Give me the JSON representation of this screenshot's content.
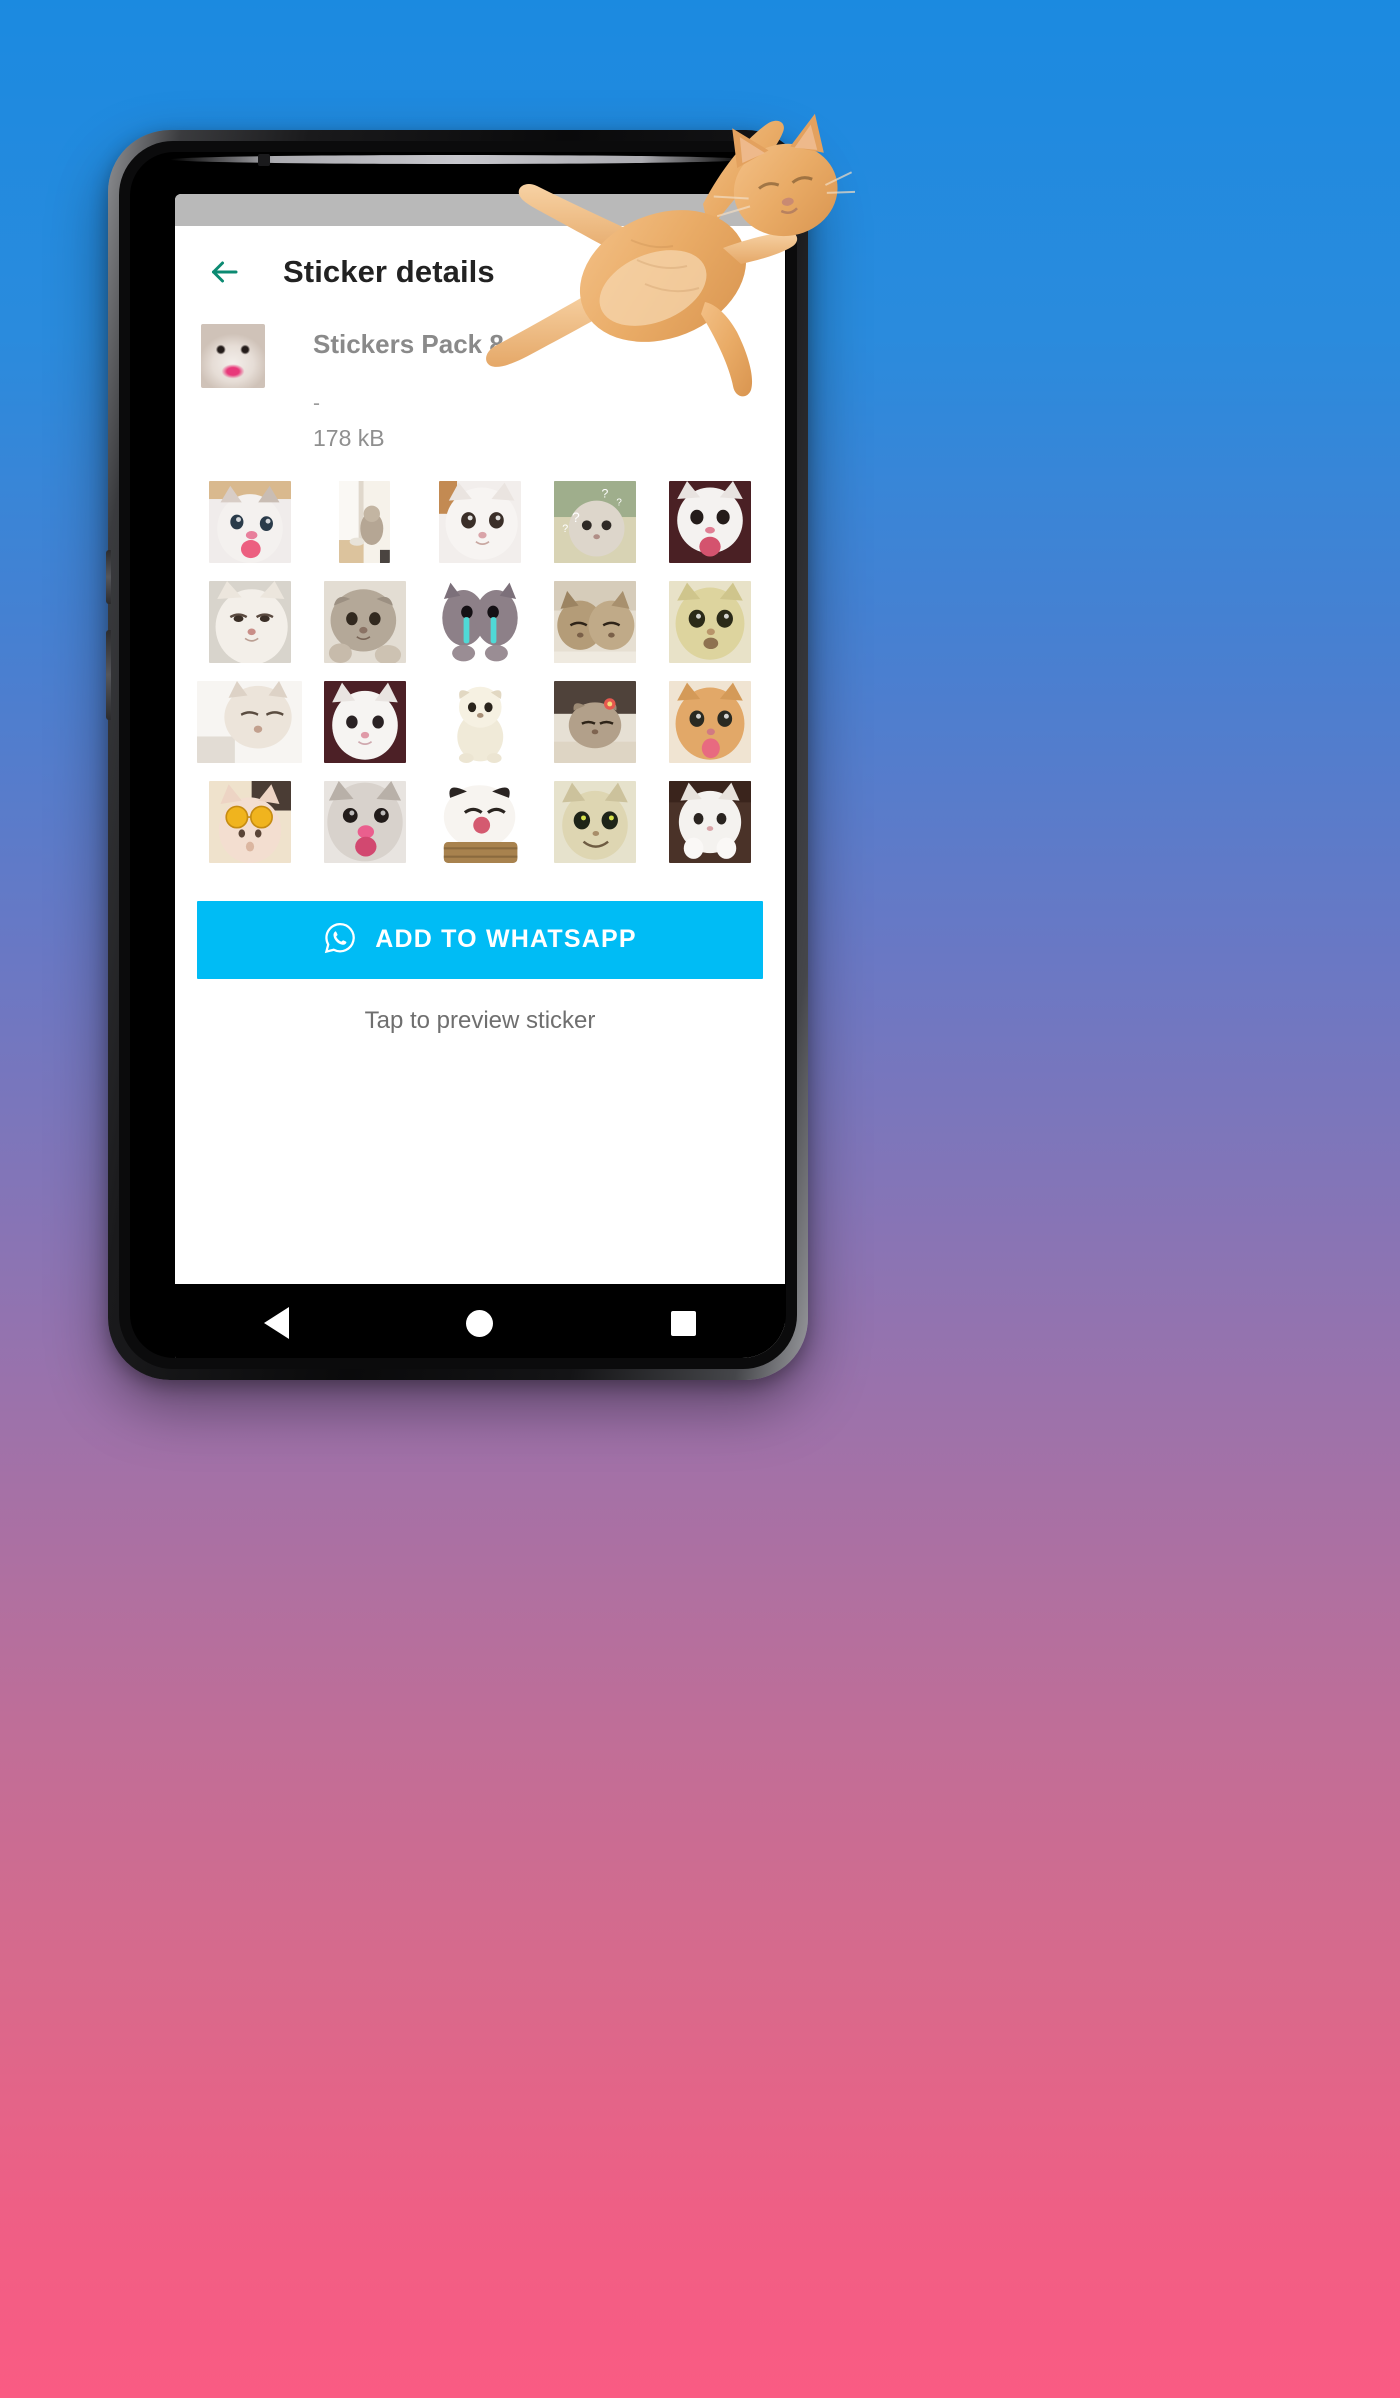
{
  "background": {
    "gradient_top": "#1b8ae0",
    "gradient_bottom": "#fa5b83"
  },
  "device": {
    "frame_color": "#0b0b0c",
    "status_bar_color": "#b9b9b9"
  },
  "app": {
    "toolbar": {
      "back_icon": "arrow-left-icon",
      "back_icon_color": "#0c8a72",
      "title": "Sticker details"
    },
    "pack_info": {
      "thumbnail_alt": "cat-sticker-thumbnail",
      "name": "Stickers Pack 8",
      "author": "-",
      "size": "178 kB"
    },
    "stickers": [
      {
        "id": 1,
        "name": "kitten-tongue-out"
      },
      {
        "id": 2,
        "name": "cat-sitting-doorway"
      },
      {
        "id": 3,
        "name": "white-cat-big-eyes"
      },
      {
        "id": 4,
        "name": "confused-cat-question-marks"
      },
      {
        "id": 5,
        "name": "white-kitten-tongue"
      },
      {
        "id": 6,
        "name": "cream-cat-side-eye"
      },
      {
        "id": 7,
        "name": "scottish-fold-grey"
      },
      {
        "id": 8,
        "name": "crying-cat-tears"
      },
      {
        "id": 9,
        "name": "two-cats-hugging"
      },
      {
        "id": 10,
        "name": "yellow-cat-surprised"
      },
      {
        "id": 11,
        "name": "flat-face-cat-resting"
      },
      {
        "id": 12,
        "name": "white-fluffy-kitten"
      },
      {
        "id": 13,
        "name": "standing-white-puppy-cat"
      },
      {
        "id": 14,
        "name": "cat-with-flower-clip"
      },
      {
        "id": 15,
        "name": "orange-kitten-tongue"
      },
      {
        "id": 16,
        "name": "cat-yellow-sunglasses"
      },
      {
        "id": 17,
        "name": "grey-cat-pink-nose"
      },
      {
        "id": 18,
        "name": "cat-in-basket-laughing"
      },
      {
        "id": 19,
        "name": "smiling-tabby-cat"
      },
      {
        "id": 20,
        "name": "white-kitten-paws-up"
      }
    ],
    "cta": {
      "icon": "whatsapp-icon",
      "label": "ADD TO WHATSAPP",
      "color": "#00bcf5",
      "text_color": "#ffffff"
    },
    "hint": "Tap to preview sticker"
  },
  "nav_bar": {
    "back_icon": "triangle-back-icon",
    "home_icon": "circle-home-icon",
    "recents_icon": "square-recents-icon"
  },
  "overlay": {
    "cat_image_alt": "jumping-orange-cat-overlay"
  }
}
